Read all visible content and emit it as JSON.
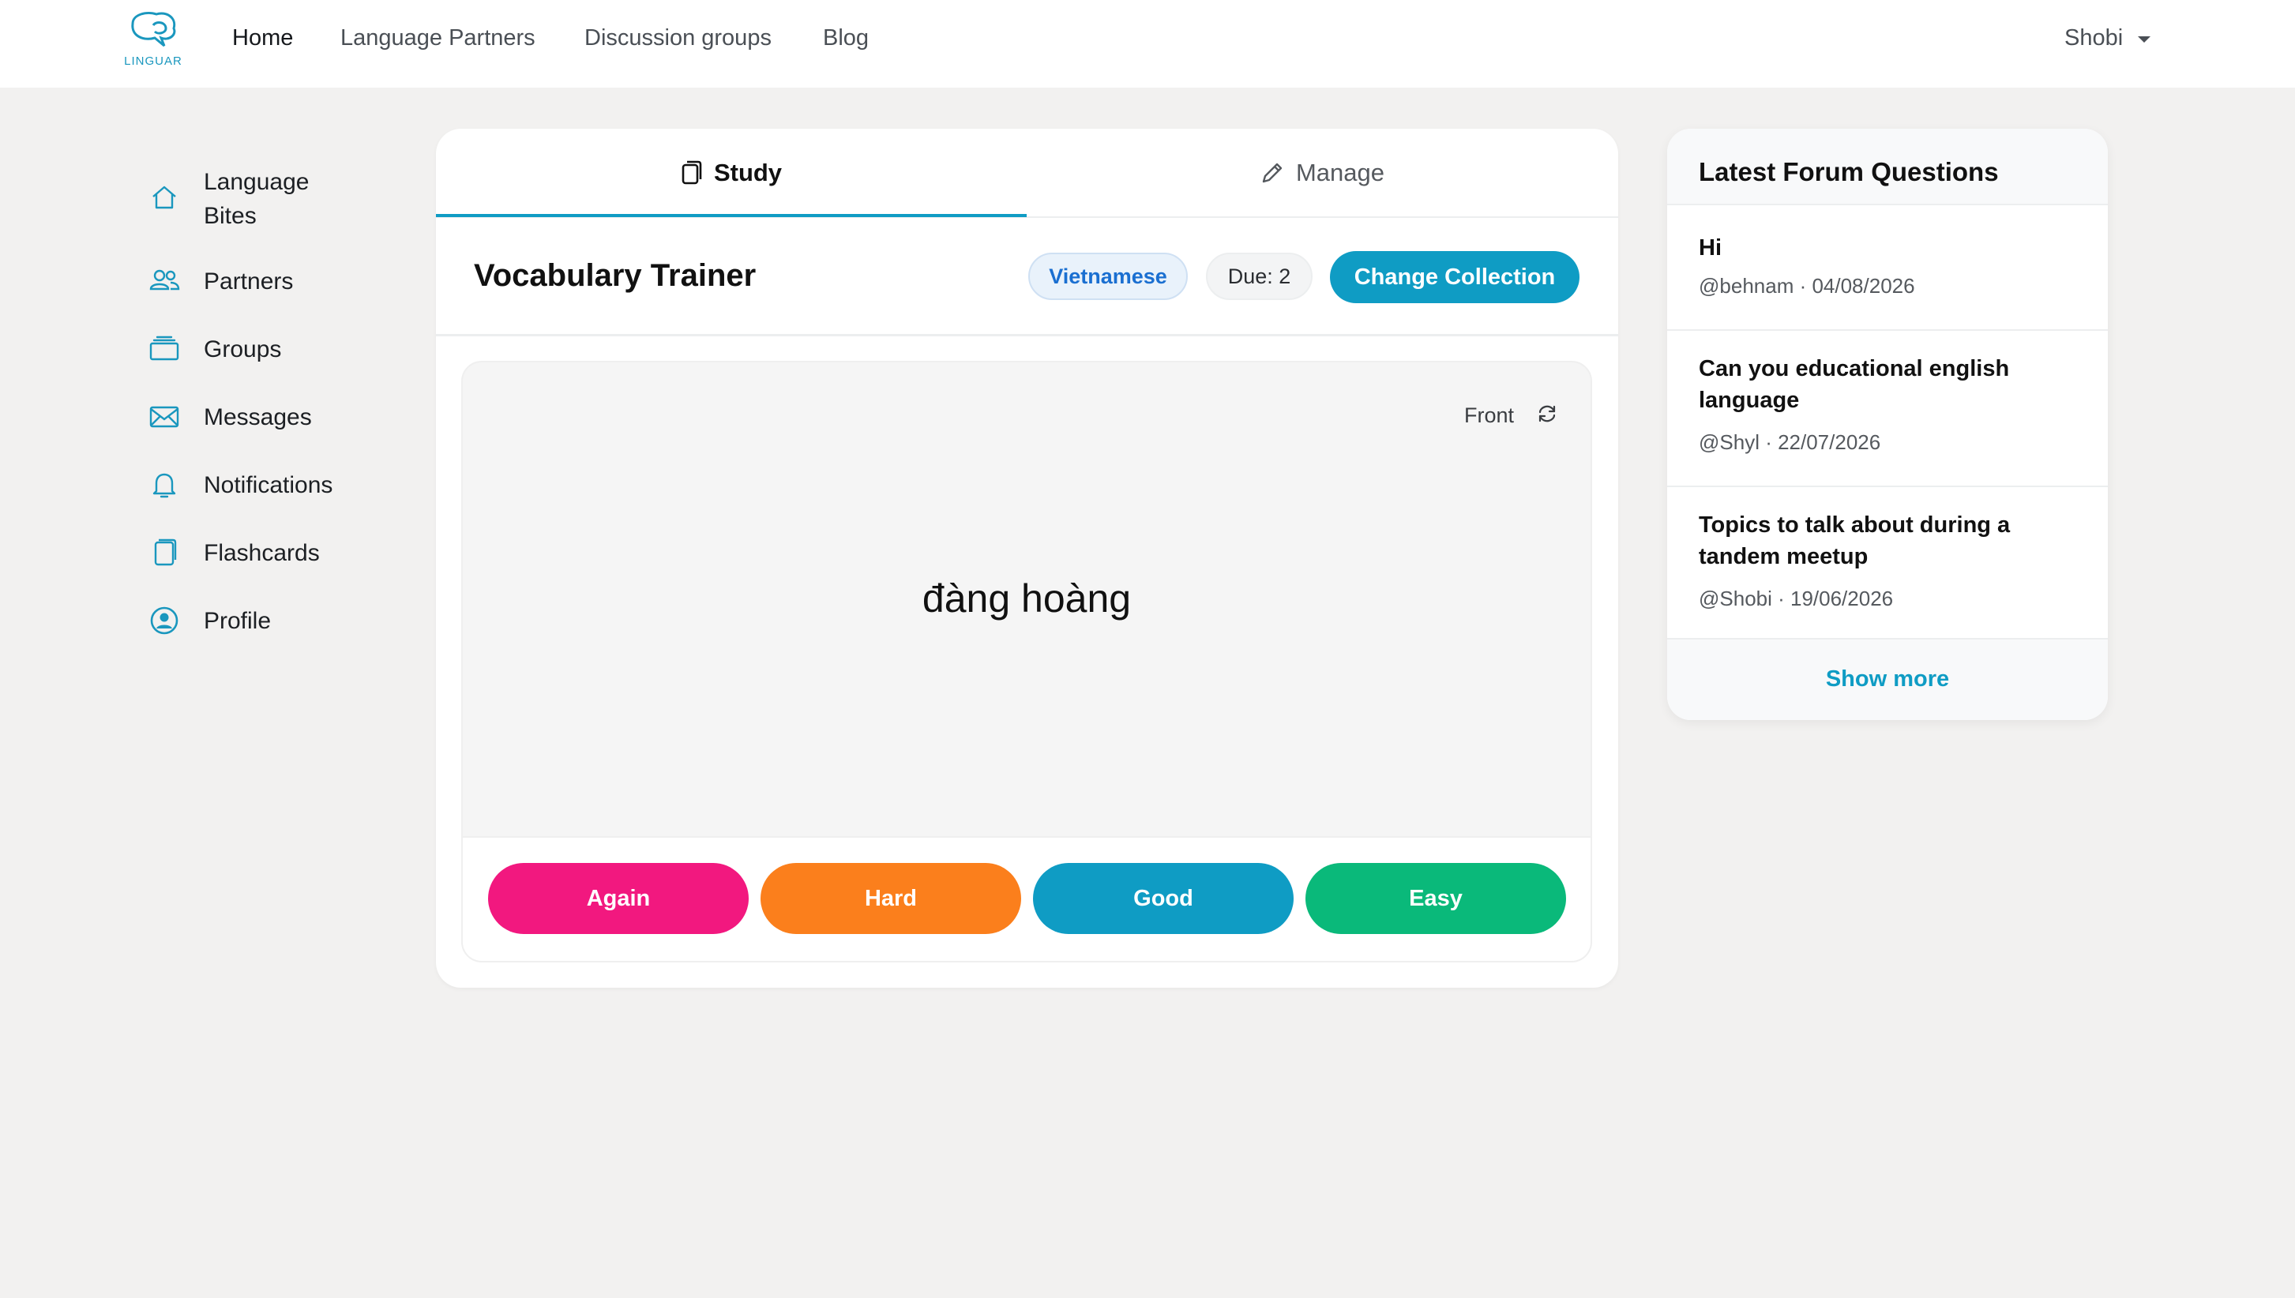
{
  "brand": {
    "name": "LINGUAR",
    "accent": "#0f9cc4"
  },
  "nav": {
    "links": [
      "Home",
      "Language Partners",
      "Discussion groups",
      "Blog"
    ],
    "user": "Shobi"
  },
  "sidebar": {
    "items": [
      {
        "label_line1": "Language",
        "label_line2": "Bites",
        "icon": "home-icon"
      },
      {
        "label": "Partners",
        "icon": "users-icon"
      },
      {
        "label": "Groups",
        "icon": "stack-icon"
      },
      {
        "label": "Messages",
        "icon": "envelope-icon"
      },
      {
        "label": "Notifications",
        "icon": "bell-icon"
      },
      {
        "label": "Flashcards",
        "icon": "cards-icon"
      },
      {
        "label": "Profile",
        "icon": "user-circle-icon"
      }
    ]
  },
  "trainer": {
    "tabs": [
      {
        "label": "Study",
        "icon": "cards-icon",
        "active": true
      },
      {
        "label": "Manage",
        "icon": "pencil-icon",
        "active": false
      }
    ],
    "title": "Vocabulary Trainer",
    "language": "Vietnamese",
    "due": "Due: 2",
    "change_collection": "Change Collection",
    "card": {
      "side_label": "Front",
      "word": "đàng hoàng"
    },
    "grades": [
      {
        "label": "Again",
        "color": "#f2187f"
      },
      {
        "label": "Hard",
        "color": "#fb7f1c"
      },
      {
        "label": "Good",
        "color": "#0f9cc4"
      },
      {
        "label": "Easy",
        "color": "#0ab97a"
      }
    ]
  },
  "forum": {
    "title": "Latest Forum Questions",
    "questions": [
      {
        "title": "Hi",
        "meta": "@behnam · 04/08/2026"
      },
      {
        "title": "Can you educational english language",
        "meta": "@Shyl · 22/07/2026"
      },
      {
        "title": "Topics to talk about during a tandem meetup",
        "meta": "@Shobi · 19/06/2026"
      }
    ],
    "show_more": "Show more"
  }
}
